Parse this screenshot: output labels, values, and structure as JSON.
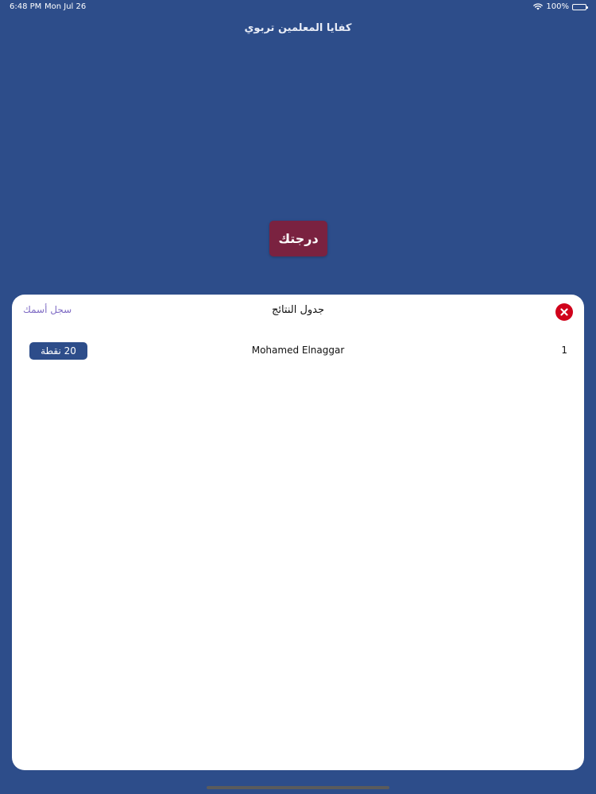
{
  "status_bar": {
    "time": "6:48 PM",
    "date": "Mon Jul 26",
    "battery": "100%"
  },
  "app": {
    "title": "كفايا المعلمين تربوي"
  },
  "score_button": {
    "label": "درجتك"
  },
  "results_sheet": {
    "title": "جدول النتائج",
    "register_label": "سجل أسمك",
    "close_icon": "close-icon",
    "rows": [
      {
        "rank": "1",
        "name": "Mohamed Elnaggar",
        "points": "20 نقطة"
      }
    ]
  },
  "colors": {
    "background": "#2d4d8a",
    "score_button": "#7a2240",
    "close_button": "#d0021b",
    "register_link": "#7f6cc4",
    "points_badge": "#2d4d8a"
  }
}
